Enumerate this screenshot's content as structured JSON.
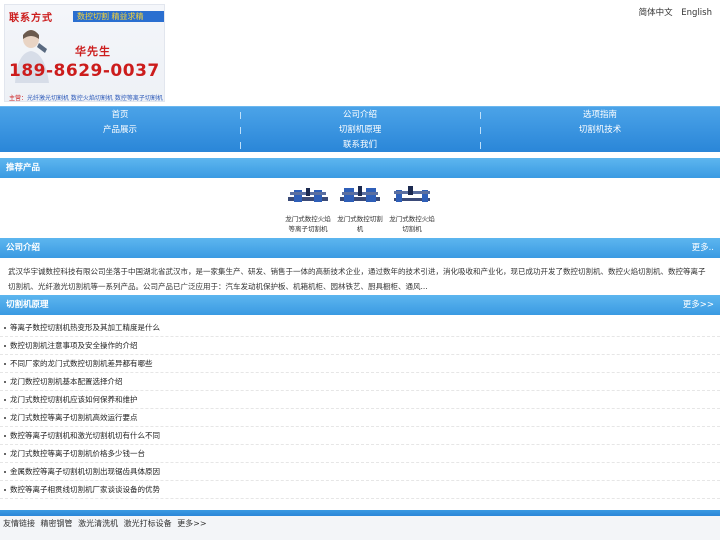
{
  "banner": {
    "contact": "联系方式",
    "tagline": "数控切割 精益求精",
    "name": "华先生",
    "phone": "189-8629-0037",
    "main_label": "主营：",
    "main_items": "光纤激光切割机 数控火焰切割机 数控等离子切割机"
  },
  "lang": {
    "zh": "简体中文",
    "en": "English"
  },
  "nav": {
    "row1": [
      "首页",
      "公司介绍",
      "选项指南"
    ],
    "row2": [
      "产品展示",
      "切割机原理",
      "切割机技术"
    ],
    "row3": [
      "联系我们"
    ]
  },
  "recommend": {
    "title": "推荐产品"
  },
  "products": [
    {
      "caption": "龙门式数控火焰等离子切割机"
    },
    {
      "caption": "龙门式数控切割机"
    },
    {
      "caption": "龙门式数控火焰切割机"
    }
  ],
  "intro": {
    "title": "公司介绍",
    "more": "更多..",
    "text": "武汉华宇诚数控科技有限公司坐落于中国湖北省武汉市，是一家集生产、研发、销售于一体的高新技术企业，通过数年的技术引进，消化吸收和产业化，现已成功开发了数控切割机、数控火焰切割机、数控等离子切割机、光纤激光切割机等一系列产品。公司产品已广泛应用于：汽车发动机保护板、机箱机柜、园林铁艺、厨具橱柜、通风..."
  },
  "principle": {
    "title": "切割机原理",
    "more": "更多>>",
    "articles": [
      "等离子数控切割机热变形及其加工精度是什么",
      "数控切割机注意事项及安全操作的介绍",
      "不同厂家的龙门式数控切割机差异都有哪些",
      "龙门数控切割机基本配置选择介绍",
      "龙门式数控切割机应该如何保养和维护",
      "龙门式数控等离子切割机高效运行要点",
      "数控等离子切割机和激光切割机切有什么不同",
      "龙门式数控等离子切割机价格多少钱一台",
      "金属数控等离子切割机切割出现锯齿具体原因",
      "数控等离子相贯线切割机厂家谈谈设备的优势"
    ]
  },
  "footer": {
    "label": "友情链接",
    "links": [
      "精密钢管",
      "激光清洗机",
      "激光打标设备"
    ],
    "more": "更多>>"
  },
  "colors": {
    "nav_blue": "#2a86d8",
    "section_blue": "#3a9ae2",
    "banner_red": "#cc1c1c"
  }
}
